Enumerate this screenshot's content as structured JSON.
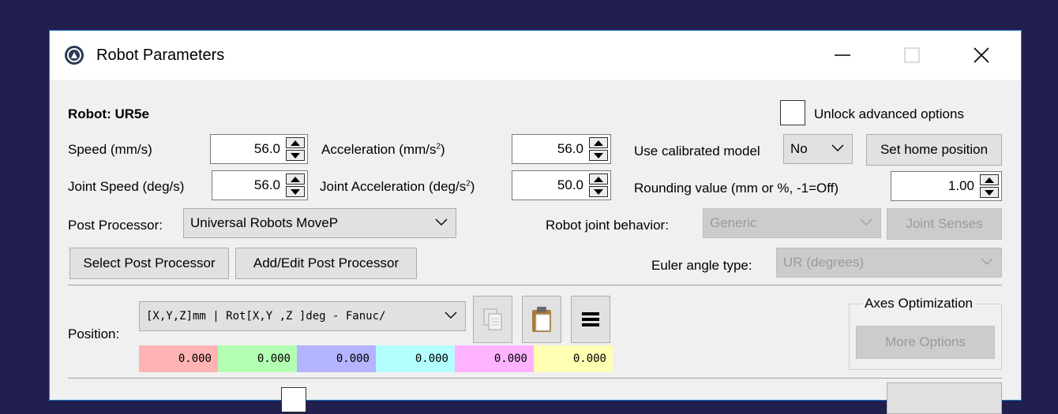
{
  "window": {
    "title": "Robot Parameters",
    "controls": {
      "minimize": "—",
      "maximize": "☐",
      "close": "✕"
    }
  },
  "robot_label": "Robot: UR5e",
  "unlock_label": "Unlock advanced options",
  "unlock_checked": false,
  "speed": {
    "label": "Speed (mm/s)",
    "value": "56.0"
  },
  "acceleration": {
    "label": "Acceleration (mm/s",
    "sup": "2",
    "label_end": ")",
    "value": "56.0"
  },
  "joint_speed": {
    "label": "Joint Speed (deg/s)",
    "value": "56.0"
  },
  "joint_acceleration": {
    "label": "Joint Acceleration (deg/s",
    "sup": "2",
    "label_end": ")",
    "value": "50.0"
  },
  "calibrated": {
    "label": "Use calibrated model",
    "value": "No"
  },
  "set_home_label": "Set home position",
  "rounding": {
    "label": "Rounding value (mm or %, -1=Off)",
    "value": "1.00"
  },
  "post_processor": {
    "label": "Post Processor:",
    "value": "Universal Robots MoveP"
  },
  "joint_behavior": {
    "label": "Robot joint behavior:",
    "value": "Generic"
  },
  "joint_senses_label": "Joint Senses",
  "select_pp_label": "Select Post Processor",
  "add_edit_pp_label": "Add/Edit Post Processor",
  "euler": {
    "label": "Euler angle type:",
    "value": "UR (degrees)"
  },
  "position": {
    "label": "Position:",
    "format": "[X,Y,Z]mm | Rot[X,Y ,Z  ]deg - Fanuc/",
    "values": [
      "0.000",
      "0.000",
      "0.000",
      "0.000",
      "0.000",
      "0.000"
    ],
    "colors": [
      "#ffb3b3",
      "#b3ffb3",
      "#b3b3ff",
      "#b3ffff",
      "#ffb3ff",
      "#ffffb3"
    ]
  },
  "axes_opt": {
    "title": "Axes Optimization",
    "more_label": "More Options"
  },
  "icons": {
    "app": "robodk-logo-icon",
    "copy": "copy-icon",
    "paste": "paste-icon",
    "menu": "hamburger-menu-icon"
  }
}
